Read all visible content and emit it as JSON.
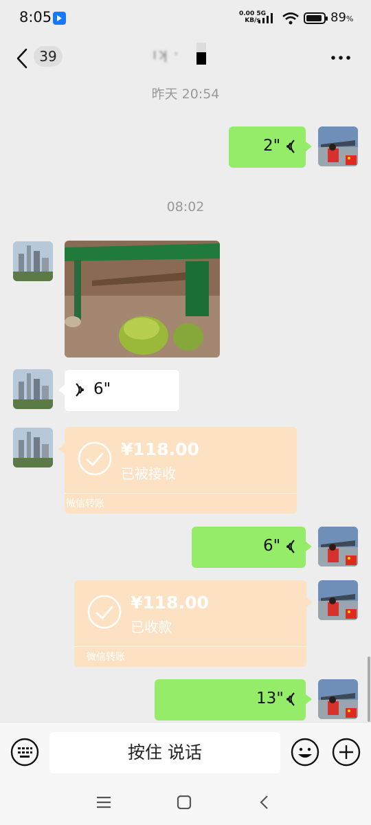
{
  "status_bar": {
    "time": "8:05",
    "net_speed_value": "0.00",
    "net_speed_unit": "KB/s",
    "network_type": "5G",
    "battery": "89",
    "battery_unit": "%"
  },
  "nav": {
    "unread_count": "39",
    "chat_title": "ıʞ ·"
  },
  "messages": {
    "ts1": "昨天 20:54",
    "ts2": "08:02",
    "voice1": "2\"",
    "voice2": "6\"",
    "voice3": "6\"",
    "voice4": "13\"",
    "transfer1": {
      "amount": "¥118.00",
      "status": "已被接收",
      "label": "微信转账"
    },
    "transfer2": {
      "amount": "¥118.00",
      "status": "已收款",
      "label": "微信转账"
    }
  },
  "input_bar": {
    "hold_to_talk": "按住 说话"
  },
  "colors": {
    "sent_bubble": "#95ec69",
    "received_bubble": "#ffffff",
    "transfer_card": "#fde1c3",
    "background": "#ededed"
  },
  "icons": [
    "back-arrow-icon",
    "more-icon",
    "voice-icon",
    "check-circle-icon",
    "keyboard-icon",
    "emoji-icon",
    "plus-icon",
    "menu-icon",
    "home-icon",
    "back-icon"
  ]
}
